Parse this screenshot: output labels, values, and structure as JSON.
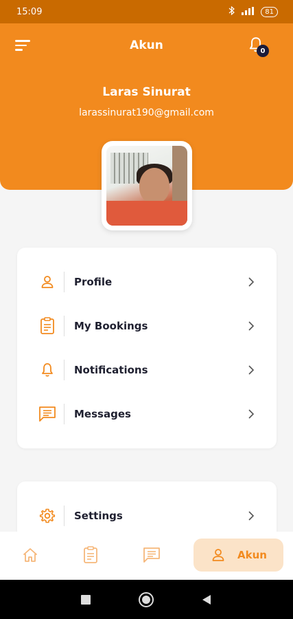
{
  "status_bar": {
    "time": "15:09",
    "battery": "81"
  },
  "header": {
    "title": "Akun",
    "notification_count": "0",
    "user_name": "Laras Sinurat",
    "user_email": "larassinurat190@gmail.com"
  },
  "menu": {
    "items": [
      {
        "label": "Profile",
        "icon": "person-icon"
      },
      {
        "label": "My Bookings",
        "icon": "clipboard-icon"
      },
      {
        "label": "Notifications",
        "icon": "bell-icon"
      },
      {
        "label": "Messages",
        "icon": "message-icon"
      }
    ]
  },
  "settings": {
    "label": "Settings",
    "icon": "gear-icon"
  },
  "bottom_nav": {
    "active_label": "Akun",
    "items": [
      "home-icon",
      "clipboard-icon",
      "message-icon",
      "person-icon"
    ]
  },
  "colors": {
    "accent": "#f28a1e",
    "status_bar": "#c96a00",
    "active_tab_bg": "#fbe3c8"
  }
}
